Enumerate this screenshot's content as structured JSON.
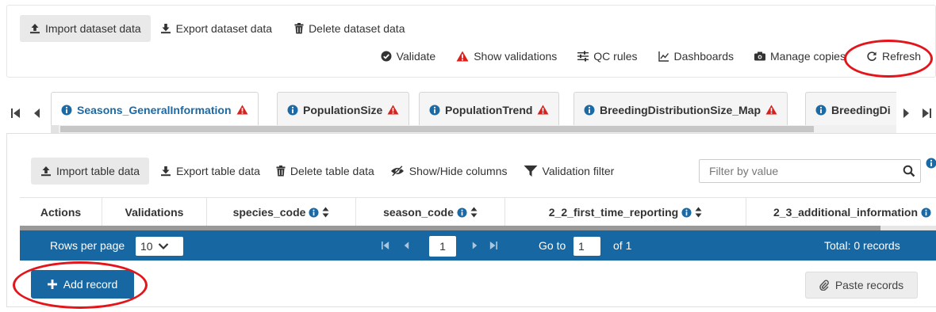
{
  "dataset_toolbar": {
    "import_label": "Import dataset data",
    "export_label": "Export dataset data",
    "delete_label": "Delete dataset data",
    "validate_label": "Validate",
    "show_validations_label": "Show validations",
    "qc_rules_label": "QC rules",
    "dashboards_label": "Dashboards",
    "manage_copies_label": "Manage copies",
    "refresh_label": "Refresh"
  },
  "tabs": [
    {
      "label": "Seasons_GeneralInformation",
      "active": true,
      "warning": true
    },
    {
      "label": "PopulationSize",
      "active": false,
      "warning": true
    },
    {
      "label": "PopulationTrend",
      "active": false,
      "warning": true
    },
    {
      "label": "BreedingDistributionSize_Map",
      "active": false,
      "warning": true
    },
    {
      "label": "BreedingDi",
      "active": false,
      "warning": false
    }
  ],
  "table_toolbar": {
    "import_label": "Import table data",
    "export_label": "Export table data",
    "delete_label": "Delete table data",
    "show_hide_label": "Show/Hide columns",
    "validation_filter_label": "Validation filter",
    "filter_placeholder": "Filter by value"
  },
  "table": {
    "columns": [
      {
        "label": "Actions",
        "sortable": false,
        "info": false
      },
      {
        "label": "Validations",
        "sortable": false,
        "info": false
      },
      {
        "label": "species_code",
        "sortable": true,
        "info": true
      },
      {
        "label": "season_code",
        "sortable": true,
        "info": true
      },
      {
        "label": "2_2_first_time_reporting",
        "sortable": true,
        "info": true
      },
      {
        "label": "2_3_additional_information",
        "sortable": false,
        "info": true
      }
    ]
  },
  "pager": {
    "rows_per_page_label": "Rows per page",
    "rows_per_page_value": "10",
    "current_page": "1",
    "goto_label": "Go to",
    "goto_value": "1",
    "of_label": "of 1",
    "total_label": "Total: 0 records"
  },
  "actions": {
    "add_record_label": "Add record",
    "paste_records_label": "Paste records"
  },
  "colors": {
    "primary": "#1767a2",
    "warning": "#d9201c",
    "annotation": "#e3151a"
  }
}
